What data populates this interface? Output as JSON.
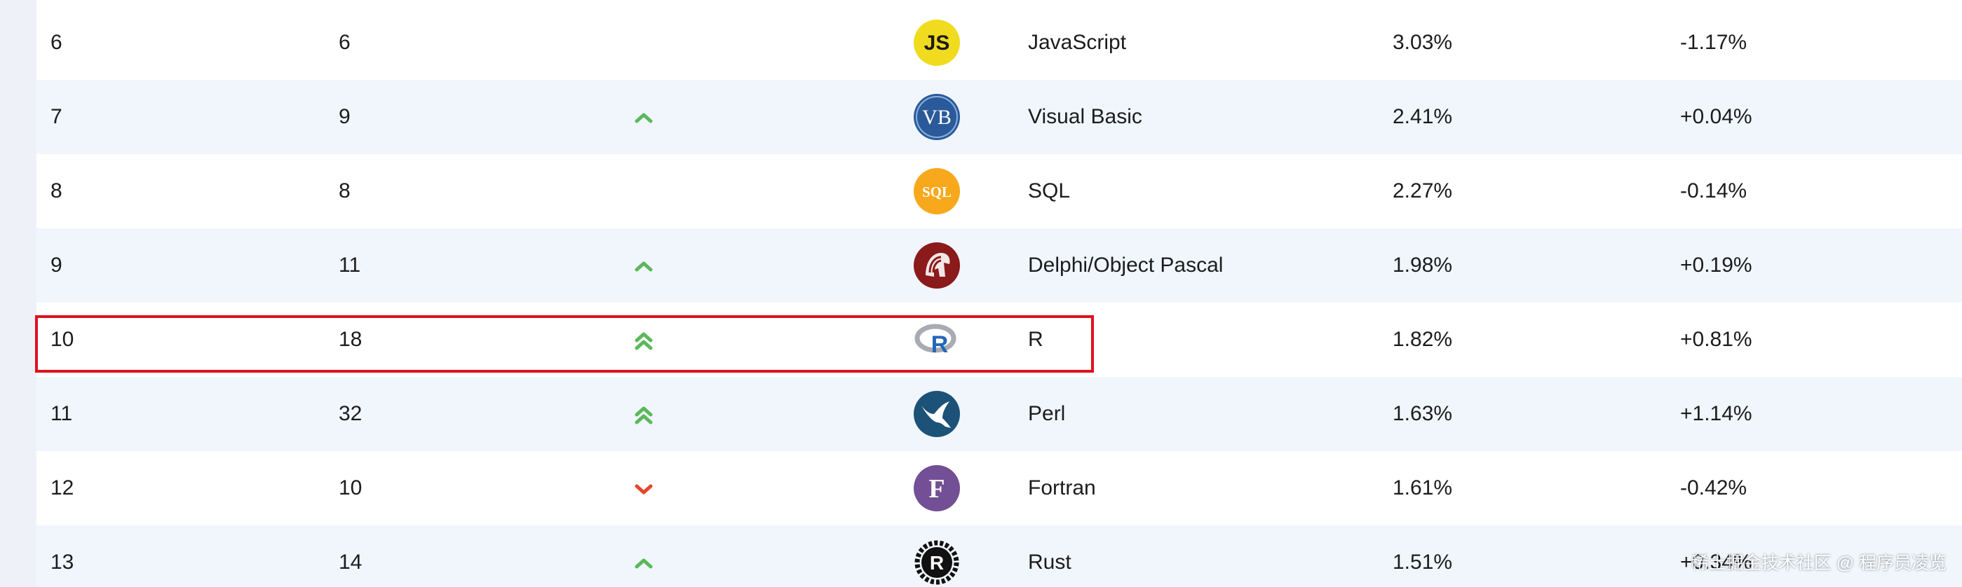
{
  "rows": [
    {
      "rank": "6",
      "prev": "6",
      "change": "none",
      "logo": "js-logo-icon",
      "logo_text": "JS",
      "name": "JavaScript",
      "rating": "3.03%",
      "delta": "-1.17%"
    },
    {
      "rank": "7",
      "prev": "9",
      "change": "up",
      "logo": "vb-logo-icon",
      "logo_text": "VB",
      "name": "Visual Basic",
      "rating": "2.41%",
      "delta": "+0.04%"
    },
    {
      "rank": "8",
      "prev": "8",
      "change": "none",
      "logo": "sql-logo-icon",
      "logo_text": "SQL",
      "name": "SQL",
      "rating": "2.27%",
      "delta": "-0.14%"
    },
    {
      "rank": "9",
      "prev": "11",
      "change": "up",
      "logo": "delphi-logo-icon",
      "logo_text": "",
      "name": "Delphi/Object Pascal",
      "rating": "1.98%",
      "delta": "+0.19%"
    },
    {
      "rank": "10",
      "prev": "18",
      "change": "double-up",
      "logo": "r-logo-icon",
      "logo_text": "R",
      "name": "R",
      "rating": "1.82%",
      "delta": "+0.81%"
    },
    {
      "rank": "11",
      "prev": "32",
      "change": "double-up",
      "logo": "perl-logo-icon",
      "logo_text": "",
      "name": "Perl",
      "rating": "1.63%",
      "delta": "+1.14%"
    },
    {
      "rank": "12",
      "prev": "10",
      "change": "down",
      "logo": "fortran-logo-icon",
      "logo_text": "F",
      "name": "Fortran",
      "rating": "1.61%",
      "delta": "-0.42%"
    },
    {
      "rank": "13",
      "prev": "14",
      "change": "up",
      "logo": "rust-logo-icon",
      "logo_text": "R",
      "name": "Rust",
      "rating": "1.51%",
      "delta": "+0.34%"
    }
  ],
  "watermark": "稀土掘金技术社区 @ 程序员凌览",
  "colors": {
    "up": "#5cb85c",
    "down": "#e5462c",
    "highlight": "#e01020",
    "row_alt": "#f1f6fd"
  }
}
